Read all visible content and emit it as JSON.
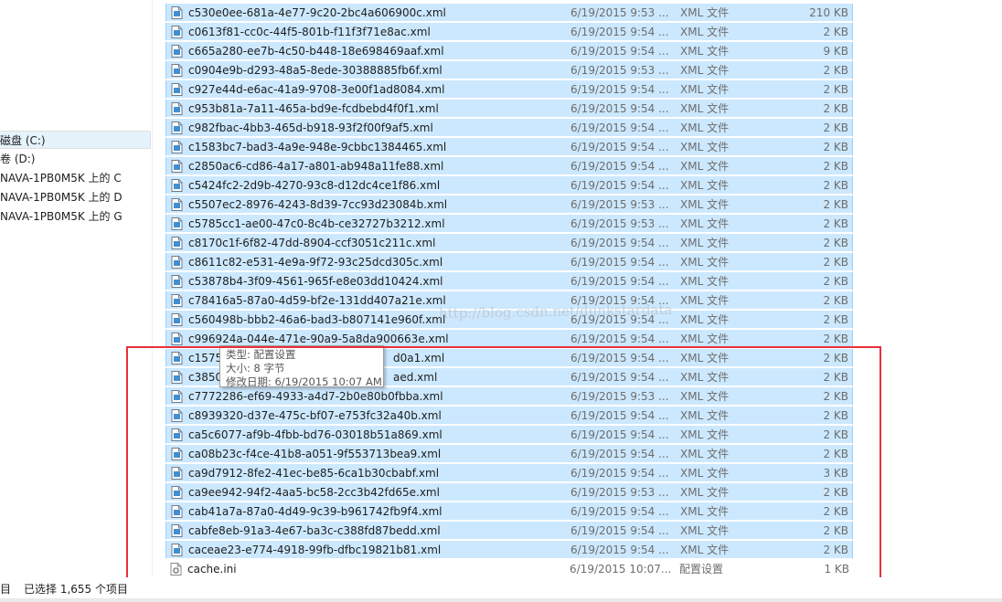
{
  "nav": {
    "items": [
      {
        "label": "磁盘 (C:)",
        "selected": true
      },
      {
        "label": "卷 (D:)",
        "selected": false
      },
      {
        "label": "NAVA-1PB0M5K 上的 C",
        "selected": false
      },
      {
        "label": "NAVA-1PB0M5K 上的 D",
        "selected": false
      },
      {
        "label": "NAVA-1PB0M5K 上的 G",
        "selected": false
      }
    ]
  },
  "files": [
    {
      "name": "c530e0ee-681a-4e77-9c20-2bc4a606900c.xml",
      "date": "6/19/2015 9:53 ...",
      "type": "XML 文件",
      "size": "210 KB",
      "selected": true
    },
    {
      "name": "c0613f81-cc0c-44f5-801b-f11f3f71e8ac.xml",
      "date": "6/19/2015 9:54 ...",
      "type": "XML 文件",
      "size": "2 KB",
      "selected": true
    },
    {
      "name": "c665a280-ee7b-4c50-b448-18e698469aaf.xml",
      "date": "6/19/2015 9:54 ...",
      "type": "XML 文件",
      "size": "9 KB",
      "selected": true
    },
    {
      "name": "c0904e9b-d293-48a5-8ede-30388885fb6f.xml",
      "date": "6/19/2015 9:53 ...",
      "type": "XML 文件",
      "size": "2 KB",
      "selected": true
    },
    {
      "name": "c927e44d-e6ac-41a9-9708-3e00f1ad8084.xml",
      "date": "6/19/2015 9:54 ...",
      "type": "XML 文件",
      "size": "2 KB",
      "selected": true
    },
    {
      "name": "c953b81a-7a11-465a-bd9e-fcdbebd4f0f1.xml",
      "date": "6/19/2015 9:54 ...",
      "type": "XML 文件",
      "size": "2 KB",
      "selected": true
    },
    {
      "name": "c982fbac-4bb3-465d-b918-93f2f00f9af5.xml",
      "date": "6/19/2015 9:54 ...",
      "type": "XML 文件",
      "size": "2 KB",
      "selected": true
    },
    {
      "name": "c1583bc7-bad3-4a9e-948e-9cbbc1384465.xml",
      "date": "6/19/2015 9:54 ...",
      "type": "XML 文件",
      "size": "2 KB",
      "selected": true
    },
    {
      "name": "c2850ac6-cd86-4a17-a801-ab948a11fe88.xml",
      "date": "6/19/2015 9:54 ...",
      "type": "XML 文件",
      "size": "2 KB",
      "selected": true
    },
    {
      "name": "c5424fc2-2d9b-4270-93c8-d12dc4ce1f86.xml",
      "date": "6/19/2015 9:54 ...",
      "type": "XML 文件",
      "size": "2 KB",
      "selected": true
    },
    {
      "name": "c5507ec2-8976-4243-8d39-7cc93d23084b.xml",
      "date": "6/19/2015 9:53 ...",
      "type": "XML 文件",
      "size": "2 KB",
      "selected": true
    },
    {
      "name": "c5785cc1-ae00-47c0-8c4b-ce32727b3212.xml",
      "date": "6/19/2015 9:53 ...",
      "type": "XML 文件",
      "size": "2 KB",
      "selected": true
    },
    {
      "name": "c8170c1f-6f82-47dd-8904-ccf3051c211c.xml",
      "date": "6/19/2015 9:54 ...",
      "type": "XML 文件",
      "size": "2 KB",
      "selected": true
    },
    {
      "name": "c8611c82-e531-4e9a-9f72-93c25dcd305c.xml",
      "date": "6/19/2015 9:54 ...",
      "type": "XML 文件",
      "size": "2 KB",
      "selected": true
    },
    {
      "name": "c53878b4-3f09-4561-965f-e8e03dd10424.xml",
      "date": "6/19/2015 9:54 ...",
      "type": "XML 文件",
      "size": "2 KB",
      "selected": true
    },
    {
      "name": "c78416a5-87a0-4d59-bf2e-131dd407a21e.xml",
      "date": "6/19/2015 9:54 ...",
      "type": "XML 文件",
      "size": "2 KB",
      "selected": true
    },
    {
      "name": "c560498b-bbb2-46a6-bad3-b807141e960f.xml",
      "date": "6/19/2015 9:54 ...",
      "type": "XML 文件",
      "size": "2 KB",
      "selected": true
    },
    {
      "name": "c996924a-044e-471e-90a9-5a8da900663e.xml",
      "date": "6/19/2015 9:54 ...",
      "type": "XML 文件",
      "size": "2 KB",
      "selected": true
    },
    {
      "name": "c1575",
      "name_tail": "d0a1.xml",
      "date": "6/19/2015 9:54 ...",
      "type": "XML 文件",
      "size": "2 KB",
      "selected": true
    },
    {
      "name": "c3850",
      "name_tail": "aed.xml",
      "date": "6/19/2015 9:54 ...",
      "type": "XML 文件",
      "size": "2 KB",
      "selected": true
    },
    {
      "name": "c7772286-ef69-4933-a4d7-2b0e80b0fbba.xml",
      "date": "6/19/2015 9:53 ...",
      "type": "XML 文件",
      "size": "2 KB",
      "selected": true
    },
    {
      "name": "c8939320-d37e-475c-bf07-e753fc32a40b.xml",
      "date": "6/19/2015 9:54 ...",
      "type": "XML 文件",
      "size": "2 KB",
      "selected": true
    },
    {
      "name": "ca5c6077-af9b-4fbb-bd76-03018b51a869.xml",
      "date": "6/19/2015 9:54 ...",
      "type": "XML 文件",
      "size": "2 KB",
      "selected": true
    },
    {
      "name": "ca08b23c-f4ce-41b8-a051-9f553713bea9.xml",
      "date": "6/19/2015 9:54 ...",
      "type": "XML 文件",
      "size": "2 KB",
      "selected": true
    },
    {
      "name": "ca9d7912-8fe2-41ec-be85-6ca1b30cbabf.xml",
      "date": "6/19/2015 9:54 ...",
      "type": "XML 文件",
      "size": "3 KB",
      "selected": true
    },
    {
      "name": "ca9ee942-94f2-4aa5-bc58-2cc3b42fd65e.xml",
      "date": "6/19/2015 9:53 ...",
      "type": "XML 文件",
      "size": "2 KB",
      "selected": true
    },
    {
      "name": "cab41a7a-87a0-4d49-9c39-b961742fb9f4.xml",
      "date": "6/19/2015 9:54 ...",
      "type": "XML 文件",
      "size": "2 KB",
      "selected": true
    },
    {
      "name": "cabfe8eb-91a3-4e67-ba3c-c388fd87bedd.xml",
      "date": "6/19/2015 9:54 ...",
      "type": "XML 文件",
      "size": "2 KB",
      "selected": true
    },
    {
      "name": "caceae23-e774-4918-99fb-dfbc19821b81.xml",
      "date": "6/19/2015 9:54 ...",
      "type": "XML 文件",
      "size": "2 KB",
      "selected": true
    },
    {
      "name": "cache.ini",
      "date": "6/19/2015 10:07...",
      "type": "配置设置",
      "size": "1 KB",
      "selected": false,
      "icon": "ini-file-icon"
    }
  ],
  "tooltip": {
    "type_line": "类型: 配置设置",
    "size_line": "大小: 8 字节",
    "date_line": "修改日期: 6/19/2015 10:07 AM"
  },
  "watermark": "http://blog.csdn.net/dunkstardata",
  "status": {
    "left": "目",
    "selection": "已选择 1,655 个项目"
  },
  "colors": {
    "selection_bg": "#cce8ff",
    "selection_border": "#99d1ff",
    "highlight_box": "#e8303a"
  }
}
